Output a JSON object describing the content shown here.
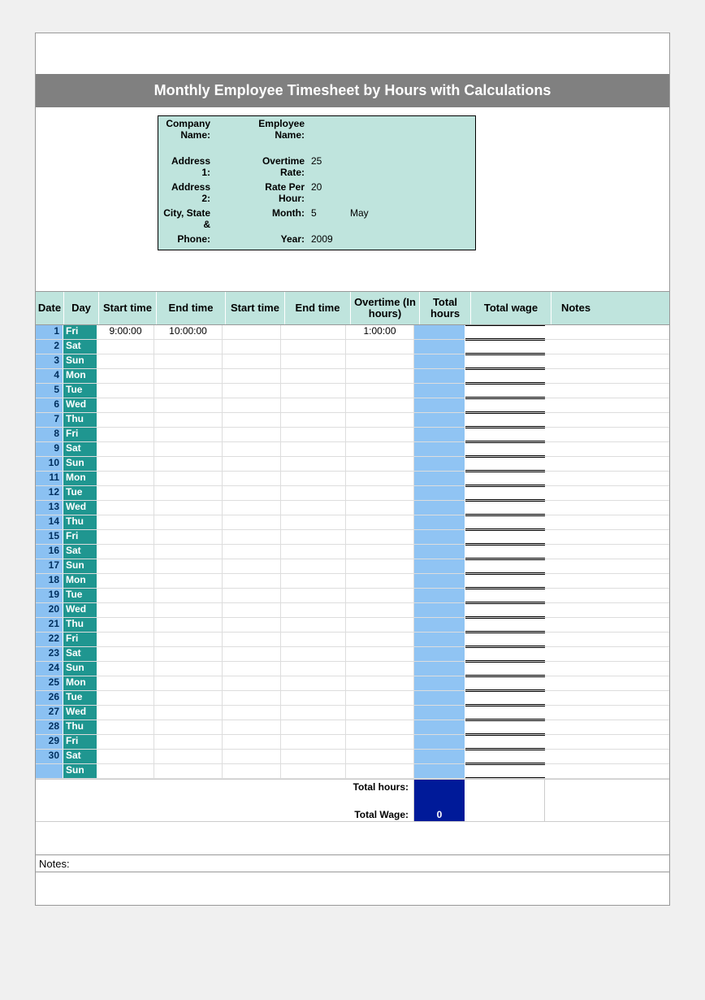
{
  "title": "Monthly Employee Timesheet by Hours with Calculations",
  "info": {
    "company_label": "Company Name:",
    "company_value": "",
    "employee_label": "Employee Name:",
    "employee_value": "",
    "address1_label": "Address 1:",
    "address1_value": "",
    "overtime_label": "Overtime Rate:",
    "overtime_value": "25",
    "address2_label": "Address 2:",
    "address2_value": "",
    "rate_label": "Rate Per Hour:",
    "rate_value": "20",
    "city_label": "City, State &",
    "city_value": "",
    "month_label": "Month:",
    "month_value": "5",
    "month_name": "May",
    "phone_label": "Phone:",
    "phone_value": "",
    "year_label": "Year:",
    "year_value": "2009"
  },
  "headers": {
    "date": "Date",
    "day": "Day",
    "start1": "Start time",
    "end1": "End time",
    "start2": "Start time",
    "end2": "End time",
    "overtime": "Overtime (In hours)",
    "total_hours": "Total hours",
    "total_wage": "Total wage",
    "notes": "Notes"
  },
  "rows": [
    {
      "date": "1",
      "day": "Fri",
      "start1": "9:00:00",
      "end1": "10:00:00",
      "start2": "",
      "end2": "",
      "ot": "1:00:00",
      "thr": "",
      "wage": "",
      "note": ""
    },
    {
      "date": "2",
      "day": "Sat",
      "start1": "",
      "end1": "",
      "start2": "",
      "end2": "",
      "ot": "",
      "thr": "",
      "wage": "",
      "note": ""
    },
    {
      "date": "3",
      "day": "Sun",
      "start1": "",
      "end1": "",
      "start2": "",
      "end2": "",
      "ot": "",
      "thr": "",
      "wage": "",
      "note": ""
    },
    {
      "date": "4",
      "day": "Mon",
      "start1": "",
      "end1": "",
      "start2": "",
      "end2": "",
      "ot": "",
      "thr": "",
      "wage": "",
      "note": ""
    },
    {
      "date": "5",
      "day": "Tue",
      "start1": "",
      "end1": "",
      "start2": "",
      "end2": "",
      "ot": "",
      "thr": "",
      "wage": "",
      "note": ""
    },
    {
      "date": "6",
      "day": "Wed",
      "start1": "",
      "end1": "",
      "start2": "",
      "end2": "",
      "ot": "",
      "thr": "",
      "wage": "",
      "note": ""
    },
    {
      "date": "7",
      "day": "Thu",
      "start1": "",
      "end1": "",
      "start2": "",
      "end2": "",
      "ot": "",
      "thr": "",
      "wage": "",
      "note": ""
    },
    {
      "date": "8",
      "day": "Fri",
      "start1": "",
      "end1": "",
      "start2": "",
      "end2": "",
      "ot": "",
      "thr": "",
      "wage": "",
      "note": ""
    },
    {
      "date": "9",
      "day": "Sat",
      "start1": "",
      "end1": "",
      "start2": "",
      "end2": "",
      "ot": "",
      "thr": "",
      "wage": "",
      "note": ""
    },
    {
      "date": "10",
      "day": "Sun",
      "start1": "",
      "end1": "",
      "start2": "",
      "end2": "",
      "ot": "",
      "thr": "",
      "wage": "",
      "note": ""
    },
    {
      "date": "11",
      "day": "Mon",
      "start1": "",
      "end1": "",
      "start2": "",
      "end2": "",
      "ot": "",
      "thr": "",
      "wage": "",
      "note": ""
    },
    {
      "date": "12",
      "day": "Tue",
      "start1": "",
      "end1": "",
      "start2": "",
      "end2": "",
      "ot": "",
      "thr": "",
      "wage": "",
      "note": ""
    },
    {
      "date": "13",
      "day": "Wed",
      "start1": "",
      "end1": "",
      "start2": "",
      "end2": "",
      "ot": "",
      "thr": "",
      "wage": "",
      "note": ""
    },
    {
      "date": "14",
      "day": "Thu",
      "start1": "",
      "end1": "",
      "start2": "",
      "end2": "",
      "ot": "",
      "thr": "",
      "wage": "",
      "note": ""
    },
    {
      "date": "15",
      "day": "Fri",
      "start1": "",
      "end1": "",
      "start2": "",
      "end2": "",
      "ot": "",
      "thr": "",
      "wage": "",
      "note": ""
    },
    {
      "date": "16",
      "day": "Sat",
      "start1": "",
      "end1": "",
      "start2": "",
      "end2": "",
      "ot": "",
      "thr": "",
      "wage": "",
      "note": ""
    },
    {
      "date": "17",
      "day": "Sun",
      "start1": "",
      "end1": "",
      "start2": "",
      "end2": "",
      "ot": "",
      "thr": "",
      "wage": "",
      "note": ""
    },
    {
      "date": "18",
      "day": "Mon",
      "start1": "",
      "end1": "",
      "start2": "",
      "end2": "",
      "ot": "",
      "thr": "",
      "wage": "",
      "note": ""
    },
    {
      "date": "19",
      "day": "Tue",
      "start1": "",
      "end1": "",
      "start2": "",
      "end2": "",
      "ot": "",
      "thr": "",
      "wage": "",
      "note": ""
    },
    {
      "date": "20",
      "day": "Wed",
      "start1": "",
      "end1": "",
      "start2": "",
      "end2": "",
      "ot": "",
      "thr": "",
      "wage": "",
      "note": ""
    },
    {
      "date": "21",
      "day": "Thu",
      "start1": "",
      "end1": "",
      "start2": "",
      "end2": "",
      "ot": "",
      "thr": "",
      "wage": "",
      "note": ""
    },
    {
      "date": "22",
      "day": "Fri",
      "start1": "",
      "end1": "",
      "start2": "",
      "end2": "",
      "ot": "",
      "thr": "",
      "wage": "",
      "note": ""
    },
    {
      "date": "23",
      "day": "Sat",
      "start1": "",
      "end1": "",
      "start2": "",
      "end2": "",
      "ot": "",
      "thr": "",
      "wage": "",
      "note": ""
    },
    {
      "date": "24",
      "day": "Sun",
      "start1": "",
      "end1": "",
      "start2": "",
      "end2": "",
      "ot": "",
      "thr": "",
      "wage": "",
      "note": ""
    },
    {
      "date": "25",
      "day": "Mon",
      "start1": "",
      "end1": "",
      "start2": "",
      "end2": "",
      "ot": "",
      "thr": "",
      "wage": "",
      "note": ""
    },
    {
      "date": "26",
      "day": "Tue",
      "start1": "",
      "end1": "",
      "start2": "",
      "end2": "",
      "ot": "",
      "thr": "",
      "wage": "",
      "note": ""
    },
    {
      "date": "27",
      "day": "Wed",
      "start1": "",
      "end1": "",
      "start2": "",
      "end2": "",
      "ot": "",
      "thr": "",
      "wage": "",
      "note": ""
    },
    {
      "date": "28",
      "day": "Thu",
      "start1": "",
      "end1": "",
      "start2": "",
      "end2": "",
      "ot": "",
      "thr": "",
      "wage": "",
      "note": ""
    },
    {
      "date": "29",
      "day": "Fri",
      "start1": "",
      "end1": "",
      "start2": "",
      "end2": "",
      "ot": "",
      "thr": "",
      "wage": "",
      "note": ""
    },
    {
      "date": "30",
      "day": "Sat",
      "start1": "",
      "end1": "",
      "start2": "",
      "end2": "",
      "ot": "",
      "thr": "",
      "wage": "",
      "note": ""
    },
    {
      "date": "",
      "day": "Sun",
      "start1": "",
      "end1": "",
      "start2": "",
      "end2": "",
      "ot": "",
      "thr": "",
      "wage": "",
      "note": ""
    }
  ],
  "totals": {
    "total_hours_label": "Total hours:",
    "total_hours_value": "",
    "total_wage_label": "Total Wage:",
    "total_wage_value": "0"
  },
  "notes_label": "Notes:"
}
